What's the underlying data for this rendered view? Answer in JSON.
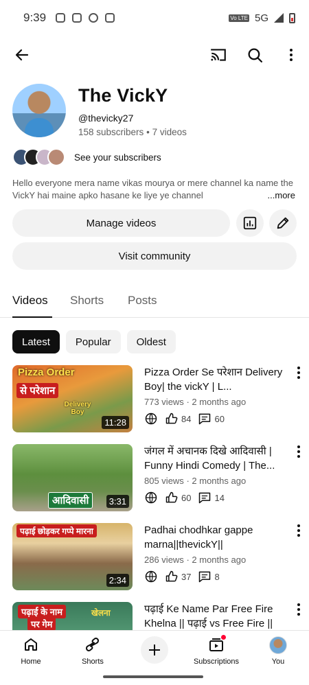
{
  "status_bar": {
    "time": "9:39",
    "network": "5G",
    "volte": "Vo LTE"
  },
  "channel": {
    "name": "The VickY",
    "handle": "@thevicky27",
    "subscribers": "158 subscribers",
    "separator": "•",
    "videos": "7 videos",
    "see_subscribers": "See your subscribers",
    "description": "Hello everyone mera name vikas mourya or mere channel ka name the VickY hai maine apko hasane ke liye ye channel",
    "more": "...more"
  },
  "actions": {
    "manage_videos": "Manage videos",
    "visit_community": "Visit community"
  },
  "tabs": [
    {
      "label": "Videos"
    },
    {
      "label": "Shorts"
    },
    {
      "label": "Posts"
    }
  ],
  "chips": [
    {
      "label": "Latest"
    },
    {
      "label": "Popular"
    },
    {
      "label": "Oldest"
    }
  ],
  "videos": [
    {
      "title": "Pizza Order Se परेशान Delivery Boy| the vickY | L...",
      "views": "773 views",
      "age": "2 months ago",
      "likes": "84",
      "comments": "60",
      "duration": "11:28",
      "thumb_text": "Pizza Order",
      "thumb_text2": "से परेशान",
      "thumb_text3": "Delivery Boy"
    },
    {
      "title": "जंगल में अचानक दिखे आदिवासी | Funny Hindi Comedy | The...",
      "views": "805 views",
      "age": "2 months ago",
      "likes": "60",
      "comments": "14",
      "duration": "3:31",
      "thumb_text": "आदिवासी"
    },
    {
      "title": "Padhai chodhkar gappe marna||thevickY||",
      "views": "286 views",
      "age": "2 months ago",
      "likes": "37",
      "comments": "8",
      "duration": "2:34",
      "thumb_text": "पढ़ाई छोड़कर गप्पे मारना"
    },
    {
      "title": "पढ़ाई Ke Name Par Free Fire Khelna || पढ़ाई vs Free Fire ||",
      "thumb_text": "पढ़ाई के नाम",
      "thumb_text2": "पर गेम",
      "thumb_text3": "खेलना"
    }
  ],
  "bottom_nav": [
    {
      "label": "Home"
    },
    {
      "label": "Shorts"
    },
    {
      "label": ""
    },
    {
      "label": "Subscriptions"
    },
    {
      "label": "You"
    }
  ],
  "meta_separator": "·",
  "colors": {
    "accent": "#0f0f0f",
    "chip_bg": "#f2f2f2",
    "muted": "#606060",
    "notification": "#ff0033"
  }
}
